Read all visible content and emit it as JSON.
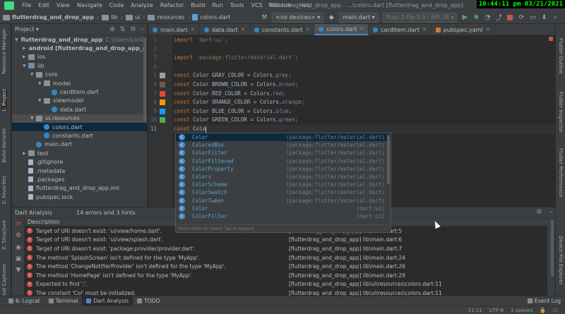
{
  "menubar": {
    "items": [
      "File",
      "Edit",
      "View",
      "Navigate",
      "Code",
      "Analyze",
      "Refactor",
      "Build",
      "Run",
      "Tools",
      "VCS",
      "Window",
      "Help"
    ],
    "window_title": "flutterdrag_and_drop_app - ...\\colors.dart [flutterdrag_and_drop_app]",
    "clock": "10:44:11 pm 03/21/2021"
  },
  "toolbar": {
    "breadcrumbs": [
      "flutterdrag_and_drop_app",
      "lib",
      "ui",
      "resources",
      "colors.dart"
    ],
    "device": "<no devices>",
    "run_config": "main.dart",
    "emulator": "Pixel 2 Pie 9.0 - API 28"
  },
  "left_strip": {
    "tabs": [
      "Resource Manager",
      "1: Project",
      "Build Variants",
      "2: Favorites",
      "Z: Structure",
      "Layout Captures"
    ]
  },
  "right_strip": {
    "tabs": [
      "Flutter Outline",
      "Flutter Inspector",
      "Flutter Performance",
      "Device File Explorer"
    ]
  },
  "project": {
    "title": "Project",
    "tree": [
      {
        "label": "flutterdrag_and_drop_app",
        "hint": "C:\\Users\\Lorilla Family",
        "indent": 0,
        "icon": "folder",
        "tri": "open",
        "bold": true
      },
      {
        "label": "android [flutterdrag_and_drop_app_android]",
        "hint": "",
        "indent": 1,
        "icon": "folder",
        "tri": "closed",
        "bold": true
      },
      {
        "label": "ios",
        "hint": "",
        "indent": 1,
        "icon": "folder",
        "tri": "closed",
        "bold": false
      },
      {
        "label": "lib",
        "hint": "",
        "indent": 1,
        "icon": "folder-blue",
        "tri": "open",
        "bold": false
      },
      {
        "label": "core",
        "hint": "",
        "indent": 2,
        "icon": "folder",
        "tri": "open",
        "bold": false
      },
      {
        "label": "model",
        "hint": "",
        "indent": 3,
        "icon": "folder",
        "tri": "open",
        "bold": false
      },
      {
        "label": "cardItem.dart",
        "hint": "",
        "indent": 4,
        "icon": "dart",
        "tri": "",
        "bold": false
      },
      {
        "label": "viewmodel",
        "hint": "",
        "indent": 3,
        "icon": "folder",
        "tri": "open",
        "bold": false
      },
      {
        "label": "data.dart",
        "hint": "",
        "indent": 4,
        "icon": "dart",
        "tri": "",
        "bold": false
      },
      {
        "label": "ui.resources",
        "hint": "",
        "indent": 2,
        "icon": "folder",
        "tri": "open",
        "bold": false,
        "highlight": true
      },
      {
        "label": "colors.dart",
        "hint": "",
        "indent": 3,
        "icon": "dart",
        "tri": "",
        "bold": false,
        "selected": true
      },
      {
        "label": "constants.dart",
        "hint": "",
        "indent": 3,
        "icon": "dart",
        "tri": "",
        "bold": false
      },
      {
        "label": "main.dart",
        "hint": "",
        "indent": 2,
        "icon": "dart",
        "tri": "",
        "bold": false
      },
      {
        "label": "test",
        "hint": "",
        "indent": 1,
        "icon": "folder",
        "tri": "closed",
        "bold": false
      },
      {
        "label": ".gitignore",
        "hint": "",
        "indent": 1,
        "icon": "file",
        "tri": "",
        "bold": false
      },
      {
        "label": ".metadata",
        "hint": "",
        "indent": 1,
        "icon": "file",
        "tri": "",
        "bold": false
      },
      {
        "label": ".packages",
        "hint": "",
        "indent": 1,
        "icon": "file",
        "tri": "",
        "bold": false
      },
      {
        "label": "flutterdrag_and_drop_app.iml",
        "hint": "",
        "indent": 1,
        "icon": "file",
        "tri": "",
        "bold": false
      },
      {
        "label": "pubspec.lock",
        "hint": "",
        "indent": 1,
        "icon": "file",
        "tri": "",
        "bold": false
      }
    ]
  },
  "editor": {
    "tabs": [
      {
        "label": "main.dart",
        "icon": "dart",
        "active": false
      },
      {
        "label": "data.dart",
        "icon": "dart",
        "active": false
      },
      {
        "label": "constants.dart",
        "icon": "dart",
        "active": false
      },
      {
        "label": "colors.dart",
        "icon": "dart",
        "active": true
      },
      {
        "label": "cardItem.dart",
        "icon": "dart",
        "active": false
      },
      {
        "label": "pubspec.yaml",
        "icon": "yaml",
        "active": false
      }
    ],
    "line_numbers": [
      "1",
      "2",
      "3",
      "4",
      "5",
      "6",
      "7",
      "8",
      "9",
      "10",
      "11"
    ],
    "current_line": "11",
    "swatches": [
      {
        "line": 5,
        "color": "#9e9e9e"
      },
      {
        "line": 6,
        "color": "#795548"
      },
      {
        "line": 7,
        "color": "#f44336"
      },
      {
        "line": 8,
        "color": "#ff9800"
      },
      {
        "line": 9,
        "color": "#2196f3"
      },
      {
        "line": 10,
        "color": "#4caf50"
      }
    ],
    "lines": [
      [
        {
          "t": "import ",
          "c": "kw"
        },
        {
          "t": "'dart:ui'",
          "c": "str"
        },
        {
          "t": ";",
          "c": "kw"
        }
      ],
      [],
      [
        {
          "t": "import ",
          "c": "kw"
        },
        {
          "t": "'package:flutter/material.dart'",
          "c": "str"
        },
        {
          "t": ";",
          "c": "kw"
        }
      ],
      [],
      [
        {
          "t": "const ",
          "c": "kw"
        },
        {
          "t": "Color GRAY_COLOR = Colors.",
          "c": ""
        },
        {
          "t": "grey",
          "c": "it"
        },
        {
          "t": ";",
          "c": "kw"
        }
      ],
      [
        {
          "t": "const ",
          "c": "kw"
        },
        {
          "t": "Color BROWN_COLOR = Colors.",
          "c": ""
        },
        {
          "t": "brown",
          "c": "it"
        },
        {
          "t": ";",
          "c": "kw"
        }
      ],
      [
        {
          "t": "const ",
          "c": "kw"
        },
        {
          "t": "Color RED_COLOR = Colors.",
          "c": ""
        },
        {
          "t": "red",
          "c": "it"
        },
        {
          "t": ";",
          "c": "kw"
        }
      ],
      [
        {
          "t": "const ",
          "c": "kw"
        },
        {
          "t": "Color ORANGE_COLOR = Colors.",
          "c": ""
        },
        {
          "t": "orange",
          "c": "it"
        },
        {
          "t": ";",
          "c": "kw"
        }
      ],
      [
        {
          "t": "const ",
          "c": "kw"
        },
        {
          "t": "Color BLUE_COLOR = Colors.",
          "c": ""
        },
        {
          "t": "blue",
          "c": "it"
        },
        {
          "t": ";",
          "c": "kw"
        }
      ],
      [
        {
          "t": "const ",
          "c": "kw"
        },
        {
          "t": "Color GREEN_COLOR = Colors.",
          "c": ""
        },
        {
          "t": "green",
          "c": "it"
        },
        {
          "t": ";",
          "c": "kw"
        }
      ],
      [
        {
          "t": "const ",
          "c": "kw"
        },
        {
          "t": "Colo",
          "c": ""
        }
      ]
    ]
  },
  "completion": {
    "items": [
      {
        "name": "Color",
        "source": "(package:flutter/material.dart)",
        "kind": "c"
      },
      {
        "name": "ColoredBox",
        "source": "(package:flutter/material.dart)",
        "kind": "c"
      },
      {
        "name": "ColorFilter",
        "source": "(package:flutter/material.dart)",
        "kind": "c"
      },
      {
        "name": "ColorFiltered",
        "source": "(package:flutter/material.dart)",
        "kind": "c"
      },
      {
        "name": "ColorProperty",
        "source": "(package:flutter/material.dart)",
        "kind": "c"
      },
      {
        "name": "Colors",
        "source": "(package:flutter/material.dart)",
        "kind": "c"
      },
      {
        "name": "ColorScheme",
        "source": "(package:flutter/material.dart)",
        "kind": "c"
      },
      {
        "name": "ColorSwatch",
        "source": "(package:flutter/material.dart)",
        "kind": "c"
      },
      {
        "name": "ColorTween",
        "source": "(package:flutter/material.dart)",
        "kind": "c"
      },
      {
        "name": "Color",
        "source": "(dart:ui)",
        "kind": "c"
      },
      {
        "name": "ColorFilter",
        "source": "(dart:ui)",
        "kind": "c"
      }
    ],
    "footer": "Press Enter to insert, Tab to replace"
  },
  "analysis": {
    "title": "Dart Analysis",
    "summary": "14 errors and 3 hints",
    "column_header": "Description",
    "rows": [
      {
        "description": "Target of URI doesn't exist: 'ui/view/home.dart'.",
        "location": "[flutterdrag_and_drop_app] lib\\main.dart:5"
      },
      {
        "description": "Target of URI doesn't exist: 'ui/view/splash.dart'.",
        "location": "[flutterdrag_and_drop_app] lib\\main.dart:6"
      },
      {
        "description": "Target of URI doesn't exist: 'package:provider/provider.dart'.",
        "location": "[flutterdrag_and_drop_app] lib\\main.dart:7"
      },
      {
        "description": "The method 'SplashScreen' isn't defined for the type 'MyApp'.",
        "location": "[flutterdrag_and_drop_app] lib\\main.dart:24"
      },
      {
        "description": "The method 'ChangeNotifierProvider' isn't defined for the type 'MyApp'.",
        "location": "[flutterdrag_and_drop_app] lib\\main.dart:26"
      },
      {
        "description": "The method 'HomePage' isn't defined for the type 'MyApp'.",
        "location": "[flutterdrag_and_drop_app] lib\\main.dart:29"
      },
      {
        "description": "Expected to find ';'.",
        "location": "[flutterdrag_and_drop_app] lib\\ui\\resources\\colors.dart:11"
      },
      {
        "description": "The constant 'Col' must be initialized.",
        "location": "[flutterdrag_and_drop_app] lib\\ui\\resources\\colors.dart:11"
      }
    ]
  },
  "bottom_tools": {
    "tabs": [
      "6: Logcat",
      "Terminal",
      "Dart Analysis",
      "TODO"
    ],
    "active": "Dart Analysis",
    "event_log": "Event Log"
  },
  "status": {
    "items": [
      "11:11",
      "UTF-8",
      "2 spaces"
    ]
  }
}
